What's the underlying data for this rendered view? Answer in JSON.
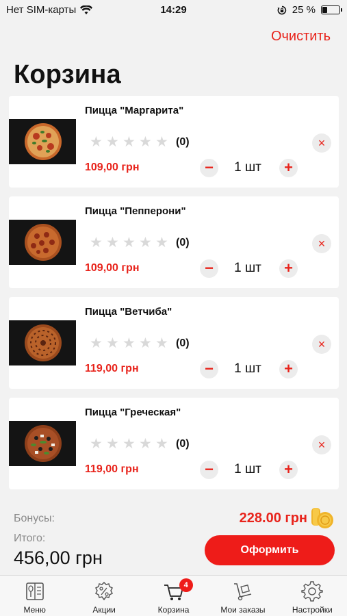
{
  "status_bar": {
    "carrier": "Нет SIM-карты",
    "time": "14:29",
    "battery_text": "25 %",
    "battery_level": 0.25
  },
  "header": {
    "clear_label": "Очистить",
    "title": "Корзина"
  },
  "cart": {
    "items": [
      {
        "name": "Пицца \"Маргарита\"",
        "rating_count": "(0)",
        "price": "109,00 грн",
        "quantity": "1 шт",
        "rating": 0,
        "image": "pizza-margherita-photo"
      },
      {
        "name": "Пицца \"Пепперони\"",
        "rating_count": "(0)",
        "price": "109,00 грн",
        "quantity": "1 шт",
        "rating": 0,
        "image": "pizza-pepperoni-photo"
      },
      {
        "name": "Пицца \"Ветчиба\"",
        "rating_count": "(0)",
        "price": "119,00 грн",
        "quantity": "1 шт",
        "rating": 0,
        "image": "pizza-ham-photo"
      },
      {
        "name": "Пицца \"Греческая\"",
        "rating_count": "(0)",
        "price": "119,00 грн",
        "quantity": "1 шт",
        "rating": 0,
        "image": "pizza-greek-photo"
      }
    ],
    "minus_symbol": "−",
    "plus_symbol": "+",
    "remove_symbol": "×"
  },
  "summary": {
    "bonus_label": "Бонусы:",
    "bonus_value": "228.00 грн",
    "total_label": "Итого:",
    "total_value": "456,00 грн",
    "checkout_label": "Оформить"
  },
  "tab_bar": {
    "tabs": [
      {
        "label": "Меню",
        "icon": "menu-book-icon"
      },
      {
        "label": "Акции",
        "icon": "discount-badge-icon"
      },
      {
        "label": "Корзина",
        "icon": "cart-icon",
        "badge": "4",
        "active": true
      },
      {
        "label": "Мои заказы",
        "icon": "hand-truck-icon"
      },
      {
        "label": "Настройки",
        "icon": "gear-icon"
      }
    ]
  },
  "colors": {
    "accent": "#e8231b",
    "button": "#ee1c19",
    "background": "#f2f2f2"
  }
}
